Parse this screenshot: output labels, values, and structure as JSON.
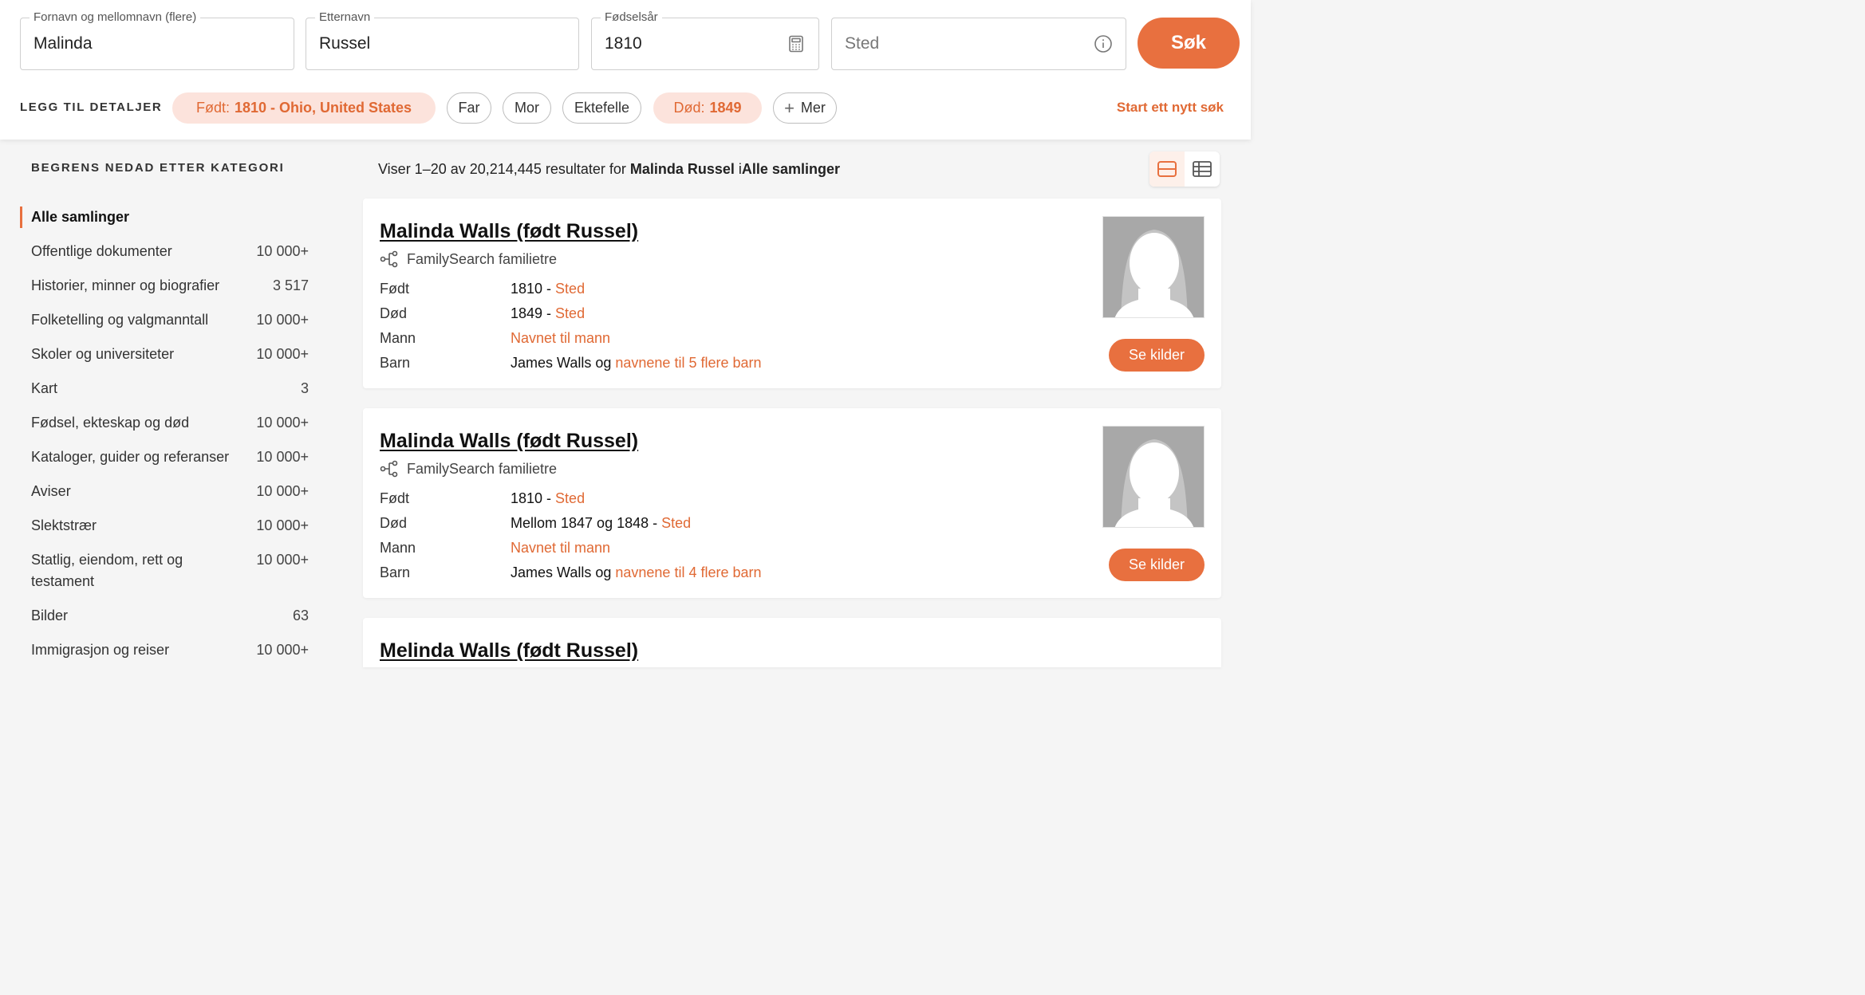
{
  "search": {
    "first_name": {
      "label": "Fornavn og mellomnavn (flere)",
      "value": "Malinda"
    },
    "last_name": {
      "label": "Etternavn",
      "value": "Russel"
    },
    "birth_year": {
      "label": "Fødselsår",
      "value": "1810"
    },
    "place": {
      "placeholder": "Sted"
    },
    "button_label": "Søk"
  },
  "details": {
    "label": "LEGG TIL DETALJER",
    "chips": {
      "born_prefix": "Født:",
      "born_value": "1810 - Ohio, United States",
      "father": "Far",
      "mother": "Mor",
      "spouse": "Ektefelle",
      "death_prefix": "Død:",
      "death_value": "1849",
      "more": "Mer"
    },
    "new_search": "Start ett nytt søk"
  },
  "sidebar": {
    "title": "BEGRENS NEDAD ETTER KATEGORI",
    "categories": [
      {
        "name": "Alle samlinger",
        "count": ""
      },
      {
        "name": "Offentlige dokumenter",
        "count": "10 000+"
      },
      {
        "name": "Historier, minner og biografier",
        "count": "3 517"
      },
      {
        "name": "Folketelling og valgmanntall",
        "count": "10 000+"
      },
      {
        "name": "Skoler og universiteter",
        "count": "10 000+"
      },
      {
        "name": "Kart",
        "count": "3"
      },
      {
        "name": "Fødsel, ekteskap og død",
        "count": "10 000+"
      },
      {
        "name": "Kataloger, guider og referanser",
        "count": "10 000+"
      },
      {
        "name": "Aviser",
        "count": "10 000+"
      },
      {
        "name": "Slektstrær",
        "count": "10 000+"
      },
      {
        "name": "Statlig, eiendom, rett og testament",
        "count": "10 000+"
      },
      {
        "name": "Bilder",
        "count": "63"
      },
      {
        "name": "Immigrasjon og reiser",
        "count": "10 000+"
      }
    ]
  },
  "results": {
    "summary_prefix": "Viser 1–20 av 20,214,445 resultater for ",
    "summary_query": "Malinda Russel",
    "summary_mid": " i",
    "summary_collection": "Alle samlinger",
    "items": [
      {
        "name": "Malinda Walls (født Russel)",
        "source": "FamilySearch familietre",
        "born_label": "Født",
        "born_value": "1810 - ",
        "born_link": "Sted",
        "death_label": "Død",
        "death_value": "1849 - ",
        "death_link": "Sted",
        "spouse_label": "Mann",
        "spouse_link": "Navnet til mann",
        "children_label": "Barn",
        "children_value": "James Walls og ",
        "children_link": "navnene til 5 flere barn",
        "button": "Se kilder"
      },
      {
        "name": "Malinda Walls (født Russel)",
        "source": "FamilySearch familietre",
        "born_label": "Født",
        "born_value": "1810 - ",
        "born_link": "Sted",
        "death_label": "Død",
        "death_value": "Mellom 1847 og 1848 - ",
        "death_link": "Sted",
        "spouse_label": "Mann",
        "spouse_link": "Navnet til mann",
        "children_label": "Barn",
        "children_value": "James Walls og ",
        "children_link": "navnene til 4 flere barn",
        "button": "Se kilder"
      },
      {
        "name": "Melinda Walls (født Russel)"
      }
    ]
  },
  "colors": {
    "accent": "#e8703f",
    "chip_active_bg": "#fce3dc",
    "link": "#e06934"
  }
}
